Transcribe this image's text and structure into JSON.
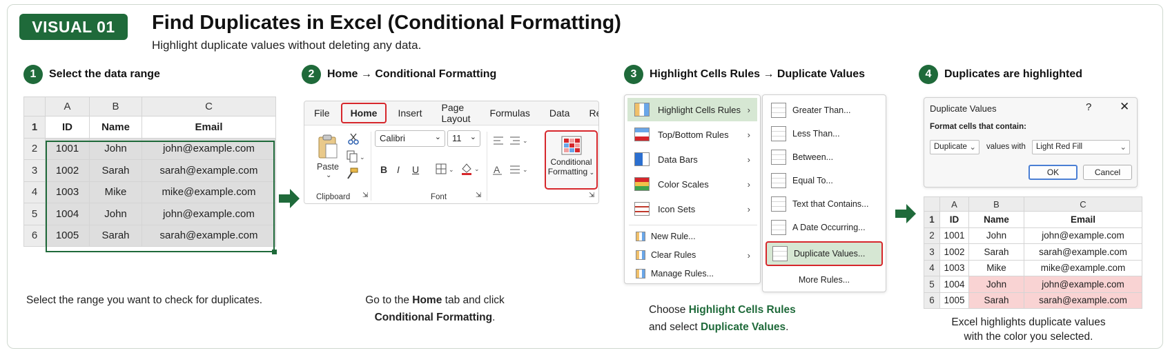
{
  "badge": "VISUAL 01",
  "title": "Find Duplicates in Excel (Conditional Formatting)",
  "subtitle": "Highlight duplicate values without deleting any data.",
  "colors": {
    "accent": "#1f6a3a",
    "highlight_red": "#d6262b",
    "dup_fill": "#f9d3d3",
    "menu_highlight": "#d6e7d3"
  },
  "steps": [
    {
      "num": "1",
      "label": "Select the data range"
    },
    {
      "num": "2",
      "label": "Home → Conditional Formatting"
    },
    {
      "num": "3",
      "label": "Highlight Cells Rules → Duplicate Values"
    },
    {
      "num": "4",
      "label": "Duplicates are highlighted"
    }
  ],
  "sheet": {
    "col_headers": [
      "A",
      "B",
      "C"
    ],
    "rows": [
      {
        "n": "1",
        "cells": [
          "ID",
          "Name",
          "Email"
        ]
      },
      {
        "n": "2",
        "cells": [
          "1001",
          "John",
          "john@example.com"
        ]
      },
      {
        "n": "3",
        "cells": [
          "1002",
          "Sarah",
          "sarah@example.com"
        ]
      },
      {
        "n": "4",
        "cells": [
          "1003",
          "Mike",
          "mike@example.com"
        ]
      },
      {
        "n": "5",
        "cells": [
          "1004",
          "John",
          "john@example.com"
        ]
      },
      {
        "n": "6",
        "cells": [
          "1005",
          "Sarah",
          "sarah@example.com"
        ]
      }
    ]
  },
  "captions": {
    "c1": "Select the range you want to check for duplicates.",
    "c2_a": "Go to the ",
    "c2_b": "Home",
    "c2_c": " tab and click",
    "c2_d": "Conditional Formatting",
    "c2_e": ".",
    "c3_a": "Choose ",
    "c3_b": "Highlight Cells Rules",
    "c3_c": "and select ",
    "c3_d": "Duplicate Values",
    "c3_e": ".",
    "c4_a": "Excel highlights duplicate values",
    "c4_b": "with the color you selected."
  },
  "ribbon": {
    "tabs": [
      "File",
      "Home",
      "Insert",
      "Page Layout",
      "Formulas",
      "Data",
      "Revi"
    ],
    "font_name": "Calibri",
    "font_size": "11",
    "paste_label": "Paste",
    "clipboard_label": "Clipboard",
    "font_label": "Font",
    "bold": "B",
    "italic": "I",
    "underline": "U",
    "cf_line1": "Conditional",
    "cf_line2": "Formatting"
  },
  "menu": {
    "main": [
      {
        "label": "Highlight Cells Rules",
        "chev": "›"
      },
      {
        "label": "Top/Bottom Rules",
        "chev": "›"
      },
      {
        "label": "Data Bars",
        "chev": "›"
      },
      {
        "label": "Color Scales",
        "chev": "›"
      },
      {
        "label": "Icon Sets",
        "chev": "›"
      }
    ],
    "small": [
      {
        "label": "New Rule..."
      },
      {
        "label": "Clear Rules",
        "chev": "›"
      },
      {
        "label": "Manage Rules..."
      }
    ],
    "sub": [
      "Greater Than...",
      "Less Than...",
      "Between...",
      "Equal To...",
      "Text that Contains...",
      "A Date Occurring...",
      "Duplicate Values...",
      "More Rules..."
    ]
  },
  "dialog": {
    "title": "Duplicate Values",
    "help": "?",
    "close": "✕",
    "label": "Format cells that contain:",
    "type_value": "Duplicate",
    "mid_text": "values with",
    "format_value": "Light Red Fill",
    "ok": "OK",
    "cancel": "Cancel"
  },
  "result_sheet": {
    "col_headers": [
      "A",
      "B",
      "C"
    ],
    "rows": [
      {
        "n": "1",
        "cells": [
          "ID",
          "Name",
          "Email"
        ],
        "dup": false
      },
      {
        "n": "2",
        "cells": [
          "1001",
          "John",
          "john@example.com"
        ],
        "dup": false
      },
      {
        "n": "3",
        "cells": [
          "1002",
          "Sarah",
          "sarah@example.com"
        ],
        "dup": false
      },
      {
        "n": "4",
        "cells": [
          "1003",
          "Mike",
          "mike@example.com"
        ],
        "dup": false
      },
      {
        "n": "5",
        "cells": [
          "1004",
          "John",
          "john@example.com"
        ],
        "dup": true
      },
      {
        "n": "6",
        "cells": [
          "1005",
          "Sarah",
          "sarah@example.com"
        ],
        "dup": true
      }
    ]
  }
}
